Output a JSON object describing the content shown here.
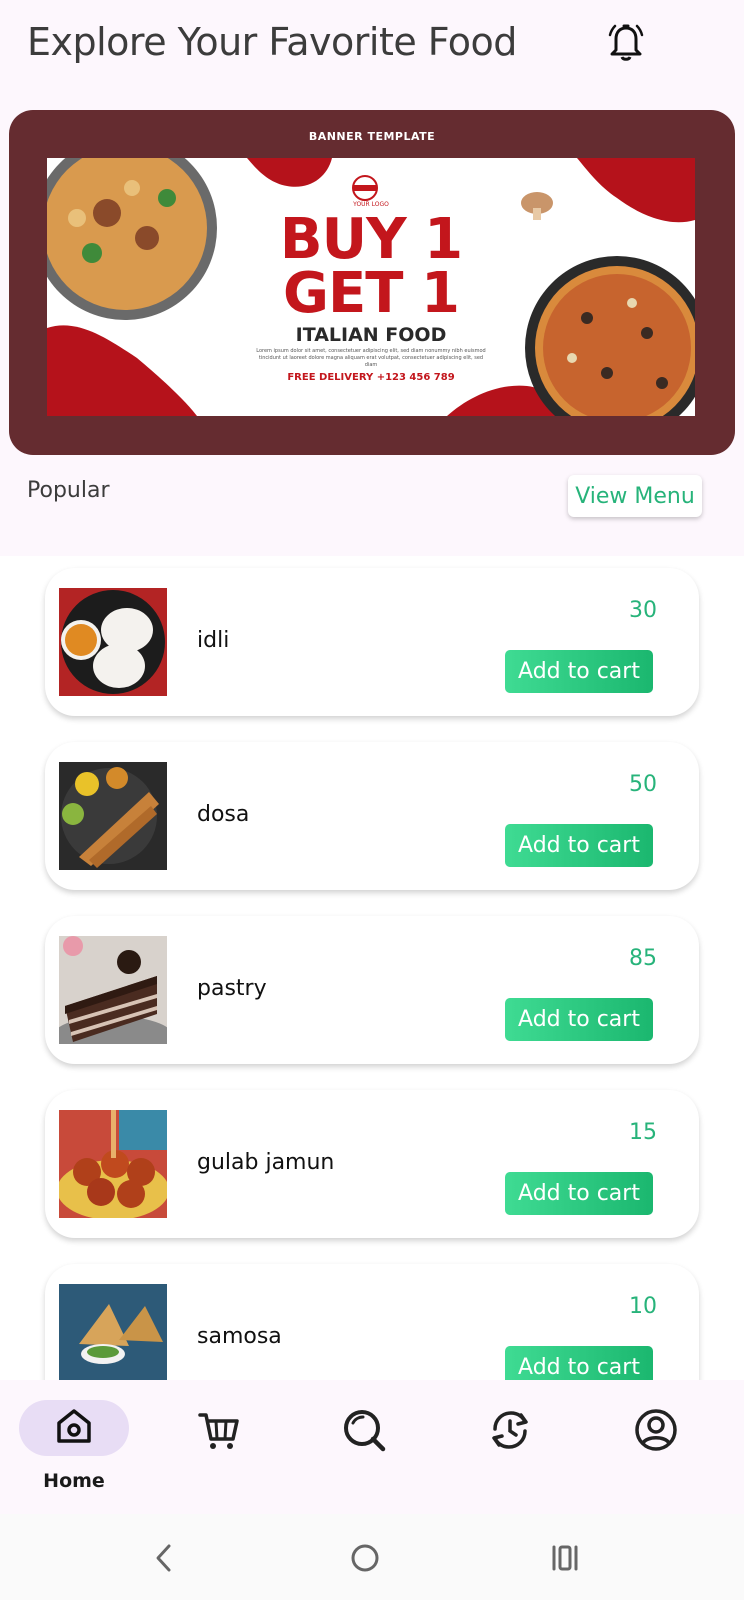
{
  "header": {
    "title": "Explore Your Favorite Food",
    "bell_icon": "bell-icon"
  },
  "banner": {
    "caption": "BANNER TEMPLATE",
    "logo_text": "YOUR LOGO",
    "headline_line1": "BUY 1",
    "headline_line2": "GET 1",
    "subtitle": "ITALIAN FOOD",
    "lorem": "Lorem ipsum dolor sit amet, consectetuer adipiscing elit, sed diam nonummy nibh euismod tincidunt ut laoreet dolore magna aliquam erat volutpat, consectetuer adipiscing elit, sed diam",
    "delivery": "FREE DELIVERY +123 456 789"
  },
  "section": {
    "label": "Popular",
    "view_menu": "View Menu"
  },
  "items": [
    {
      "name": "idli",
      "price": "30",
      "button": "Add to cart"
    },
    {
      "name": "dosa",
      "price": "50",
      "button": "Add to cart"
    },
    {
      "name": "pastry",
      "price": "85",
      "button": "Add to cart"
    },
    {
      "name": "gulab jamun",
      "price": "15",
      "button": "Add to cart"
    },
    {
      "name": "samosa",
      "price": "10",
      "button": "Add to cart"
    }
  ],
  "bottom_nav": {
    "home_label": "Home",
    "icons": [
      "home-icon",
      "cart-icon",
      "search-icon",
      "history-icon",
      "profile-icon"
    ]
  },
  "colors": {
    "accent": "#27b37a",
    "banner_bg": "#652c30",
    "nav_pill": "#e8ddf5"
  }
}
